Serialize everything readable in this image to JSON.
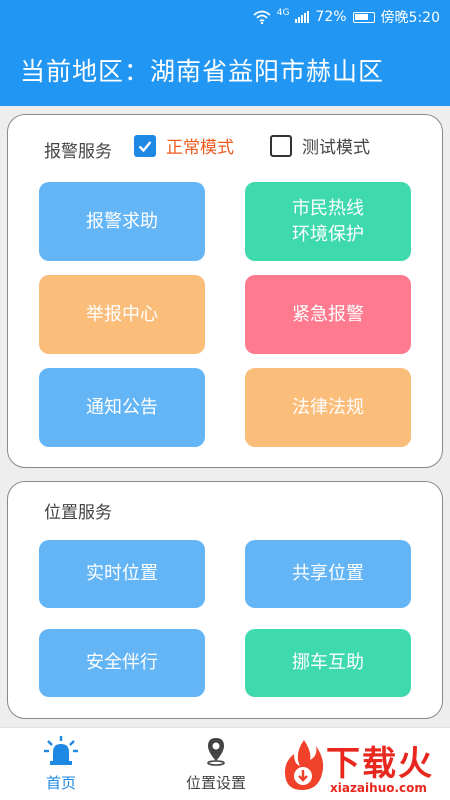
{
  "status_bar": {
    "network": "4G",
    "battery": "72%",
    "time": "傍晚5:20"
  },
  "header": {
    "title": "当前地区：湖南省益阳市赫山区"
  },
  "alarm_panel": {
    "title": "报警服务",
    "mode_normal": {
      "label": "正常模式",
      "checked": true
    },
    "mode_test": {
      "label": "测试模式",
      "checked": false
    },
    "tiles": [
      {
        "label": "报警求助",
        "color": "#64b5f6"
      },
      {
        "label": "市民热线\n环境保护",
        "color": "#3fd9ae"
      },
      {
        "label": "举报中心",
        "color": "#fbbd7a"
      },
      {
        "label": "紧急报警",
        "color": "#fe7b8f"
      },
      {
        "label": "通知公告",
        "color": "#64b5f6"
      },
      {
        "label": "法律法规",
        "color": "#fbbd7a"
      }
    ]
  },
  "location_panel": {
    "title": "位置服务",
    "tiles": [
      {
        "label": "实时位置",
        "color": "#64b5f6"
      },
      {
        "label": "共享位置",
        "color": "#64b5f6"
      },
      {
        "label": "安全伴行",
        "color": "#64b5f6"
      },
      {
        "label": "挪车互助",
        "color": "#3fd9ae"
      }
    ]
  },
  "bottom_nav": {
    "home": {
      "label": "首页",
      "icon": "alarm-light-icon",
      "active": true
    },
    "location_settings": {
      "label": "位置设置",
      "icon": "map-pin-icon",
      "active": false
    }
  },
  "watermark": {
    "brand": "下载火",
    "domain": "xiazaihuo.com"
  },
  "colors": {
    "primary": "#2196f3",
    "accent_orange": "#ef5a1f"
  }
}
